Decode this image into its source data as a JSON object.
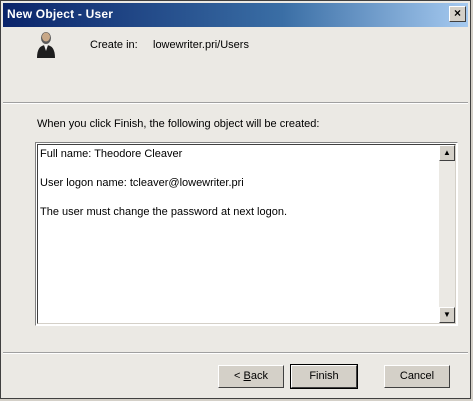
{
  "window": {
    "title": "New Object - User",
    "close_glyph": "×"
  },
  "header": {
    "icon": "user-icon",
    "create_in_label": "Create in:",
    "create_in_value": "lowewriter.pri/Users"
  },
  "info": "When you click Finish, the following object will be created:",
  "summary": {
    "lines": [
      "Full name: Theodore Cleaver",
      "User logon name: tcleaver@lowewriter.pri",
      "The user must change the password at next logon."
    ]
  },
  "buttons": {
    "back_prefix": "< ",
    "back_accel": "B",
    "back_rest": "ack",
    "finish": "Finish",
    "cancel": "Cancel"
  },
  "colors": {
    "title_start": "#0a246a",
    "title_end": "#a6caf0",
    "face": "#d4d0c8"
  }
}
